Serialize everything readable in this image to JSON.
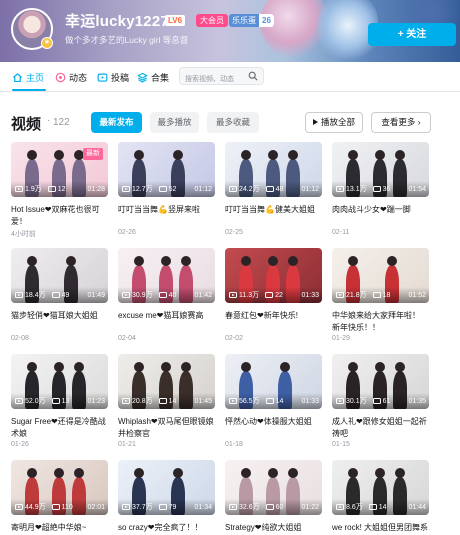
{
  "profile": {
    "username": "幸运lucky1227",
    "level": "LV6",
    "vip_label": "大会员",
    "fan_badge": "乐乐蛋",
    "fan_level": "26",
    "signature": "做个多才多艺的Lucky girl 等息督",
    "follow_label": "+ 关注",
    "avatar_badge": "★"
  },
  "nav": {
    "items": [
      {
        "label": "主页",
        "icon": "home-icon",
        "active": true
      },
      {
        "label": "动态",
        "icon": "dynamic-icon",
        "active": false
      },
      {
        "label": "投稿",
        "icon": "upload-icon",
        "active": false
      },
      {
        "label": "合集",
        "icon": "collection-icon",
        "active": false
      }
    ],
    "search_placeholder": "搜索视频、动态"
  },
  "videos_section": {
    "title": "视频",
    "separator": "·",
    "count": "122",
    "sort_tabs": [
      "最新发布",
      "最多播放",
      "最多收藏"
    ],
    "active_sort": "最新发布",
    "play_all": "播放全部",
    "see_more": "查看更多 ›"
  },
  "colors": {
    "accent": "#00aeec",
    "new_tag": "#ff6699"
  },
  "videos": [
    {
      "views": "1.9万",
      "danmaku": "12",
      "duration": "01:28",
      "title": "Hot Issue❤双麻花也很可爱！",
      "date": "4小时前",
      "tag": "最新"
    },
    {
      "views": "12.7万",
      "danmaku": "52",
      "duration": "01:12",
      "title": "叮叮当当舞💪竖屏来啦",
      "date": "02-26",
      "tag": ""
    },
    {
      "views": "24.2万",
      "danmaku": "48",
      "duration": "01:12",
      "title": "叮叮当当舞💪健美大姐姐",
      "date": "02-25",
      "tag": ""
    },
    {
      "views": "13.1万",
      "danmaku": "36",
      "duration": "01:54",
      "title": "肉肉战斗少女❤踹一脚",
      "date": "02-11",
      "tag": ""
    },
    {
      "views": "18.4万",
      "danmaku": "49",
      "duration": "01:49",
      "title": "猫步轻俏❤猫耳娘大姐姐",
      "date": "02-08",
      "tag": ""
    },
    {
      "views": "30.9万",
      "danmaku": "40",
      "duration": "01:42",
      "title": "excuse me❤猫耳娘赛高",
      "date": "02-04",
      "tag": ""
    },
    {
      "views": "11.3万",
      "danmaku": "22",
      "duration": "01:33",
      "title": "春意红包❤新年快乐!",
      "date": "02-02",
      "tag": ""
    },
    {
      "views": "21.8万",
      "danmaku": "18",
      "duration": "01:52",
      "title": "中华娘来给大家拜年啦！ 新年快乐！！",
      "date": "01-29",
      "tag": ""
    },
    {
      "views": "52.0万",
      "danmaku": "13",
      "duration": "01:23",
      "title": "Sugar Free❤还得是冷酷战术娘",
      "date": "01-26",
      "tag": ""
    },
    {
      "views": "20.8万",
      "danmaku": "14",
      "duration": "01:45",
      "title": "Whiplash❤双马尾但眼镜娘 并检察官",
      "date": "01-21",
      "tag": ""
    },
    {
      "views": "56.5万",
      "danmaku": "14",
      "duration": "01:33",
      "title": "怦然心动❤体操服大姐姐",
      "date": "01-18",
      "tag": ""
    },
    {
      "views": "30.1万",
      "danmaku": "61",
      "duration": "01:35",
      "title": "成人礼❤跟修女姐姐一起祈祷吧",
      "date": "01-15",
      "tag": ""
    },
    {
      "views": "44.9万",
      "danmaku": "110",
      "duration": "02:01",
      "title": "寄明月❤超絶中华娘~",
      "date": "",
      "tag": ""
    },
    {
      "views": "37.7万",
      "danmaku": "79",
      "duration": "01:34",
      "title": "so crazy❤完全疯了！！",
      "date": "",
      "tag": ""
    },
    {
      "views": "32.6万",
      "danmaku": "60",
      "duration": "01:22",
      "title": "Strategy❤纯欲大姐姐",
      "date": "",
      "tag": ""
    },
    {
      "views": "8.6万",
      "danmaku": "14",
      "duration": "01:44",
      "title": "we rock! 大姐姐但男团舞系",
      "date": "",
      "tag": ""
    }
  ]
}
